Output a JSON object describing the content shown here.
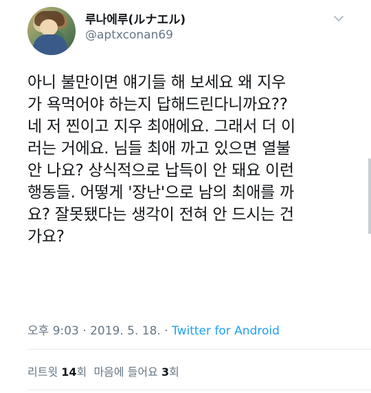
{
  "author": {
    "name": "루나에루(ルナエル)",
    "handle": "@aptxconan69"
  },
  "tweet": {
    "lines": [
      "아니 불만이면 얘기들 해 보세요 왜 지우",
      "가 욕먹어야 하는지 답해드린다니까요??",
      "네 저 찐이고 지우 최애에요. 그래서 더 이",
      "러는 거에요. 님들 최애 까고 있으면 열불",
      "안 나요? 상식적으로 납득이 안 돼요 이런",
      "행동들. 어떻게 '장난'으로 남의 최애를 까",
      "요? 잘못됐다는 생각이 전혀 안 드시는 건",
      "가요?"
    ]
  },
  "meta": {
    "timestamp": "오후 9:03 · 2019. 5. 18. · ",
    "app": "Twitter for Android"
  },
  "stats": {
    "retweet_label": "리트윗",
    "retweet_count": "14",
    "retweet_unit": "회",
    "like_label": "마음에 들어요",
    "like_count": "3",
    "like_unit": "회"
  },
  "icons": {
    "menu": "chevron-down-icon"
  },
  "colors": {
    "text": "#14171a",
    "secondary": "#657786",
    "link": "#1da1f2",
    "divider": "#e6ecf0"
  }
}
